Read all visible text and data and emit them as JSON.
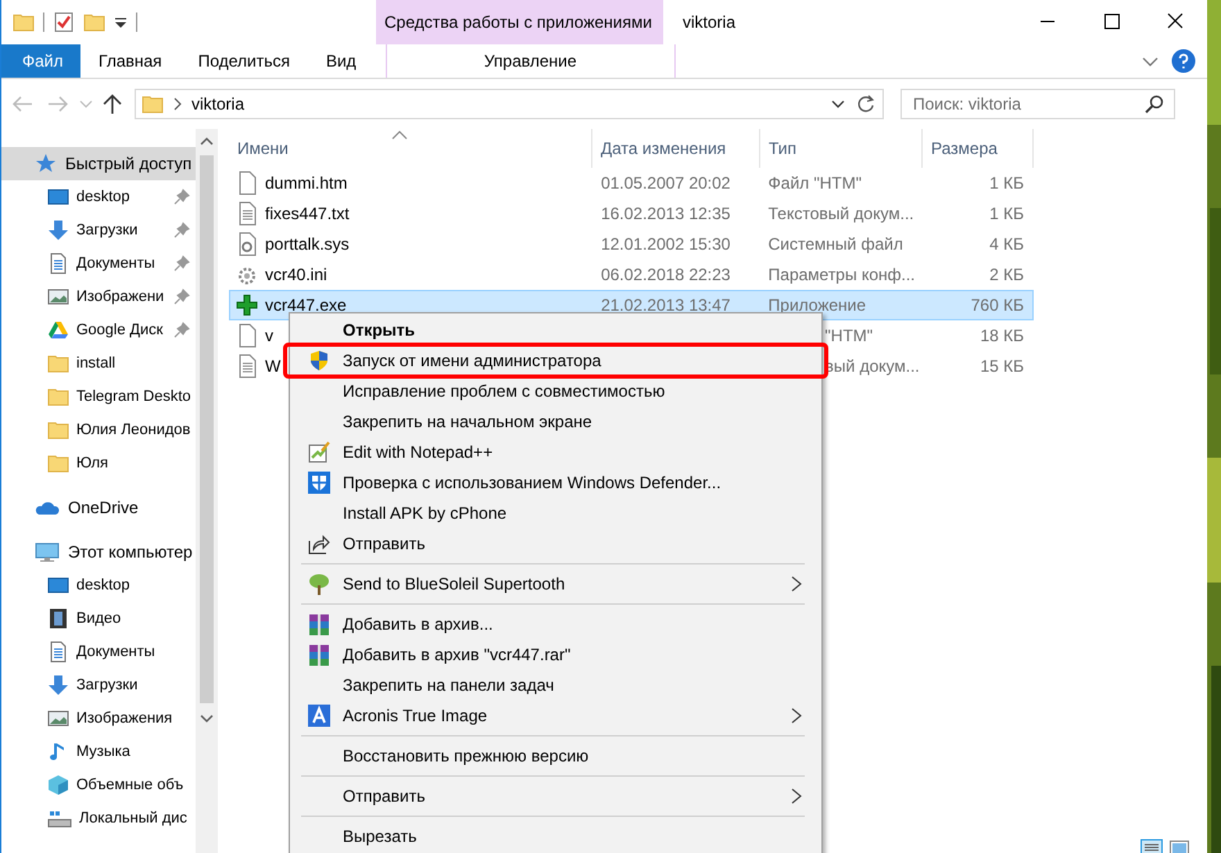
{
  "window": {
    "title": "viktoria",
    "context_group": "Средства работы с приложениями"
  },
  "ribbon": {
    "tabs": [
      {
        "label": "Файл",
        "kind": "file",
        "selected": false
      },
      {
        "label": "Главная",
        "kind": "tab",
        "selected": false
      },
      {
        "label": "Поделиться",
        "kind": "tab",
        "selected": false
      },
      {
        "label": "Вид",
        "kind": "tab",
        "selected": false
      },
      {
        "label": "Управление",
        "kind": "context",
        "selected": false
      }
    ]
  },
  "address": {
    "path": "viktoria",
    "search_placeholder": "Поиск: viktoria"
  },
  "sidebar": {
    "items": [
      {
        "label": "Быстрый доступ",
        "selected": true,
        "children": [
          {
            "label": "desktop",
            "pinned": true,
            "selected": false
          },
          {
            "label": "Загрузки",
            "pinned": true,
            "selected": false
          },
          {
            "label": "Документы",
            "pinned": true,
            "selected": false
          },
          {
            "label": "Изображени",
            "pinned": true,
            "selected": false
          },
          {
            "label": "Google Диск",
            "pinned": true,
            "selected": false
          },
          {
            "label": "install",
            "pinned": false,
            "selected": false
          },
          {
            "label": "Telegram Deskto",
            "pinned": false,
            "selected": false
          },
          {
            "label": "Юлия Леонидов",
            "pinned": false,
            "selected": false
          },
          {
            "label": "Юля",
            "pinned": false,
            "selected": false
          }
        ]
      },
      {
        "label": "OneDrive",
        "selected": false
      },
      {
        "label": "Этот компьютер",
        "selected": false,
        "children": [
          {
            "label": "desktop",
            "selected": false
          },
          {
            "label": "Видео",
            "selected": false
          },
          {
            "label": "Документы",
            "selected": false
          },
          {
            "label": "Загрузки",
            "selected": false
          },
          {
            "label": "Изображения",
            "selected": false
          },
          {
            "label": "Музыка",
            "selected": false
          },
          {
            "label": "Объемные объ",
            "selected": false
          },
          {
            "label": "Локальный дис",
            "selected": false
          }
        ]
      }
    ]
  },
  "table": {
    "columns": [
      "Имени",
      "Дата изменения",
      "Тип",
      "Размера"
    ],
    "rows": [
      {
        "name": "dummi.htm",
        "date": "01.05.2007 20:02",
        "type": "Файл \"HTM\"",
        "size": "1 КБ",
        "selected": false
      },
      {
        "name": "fixes447.txt",
        "date": "16.02.2013 12:35",
        "type": "Текстовый докум...",
        "size": "1 КБ",
        "selected": false
      },
      {
        "name": "porttalk.sys",
        "date": "12.01.2002 15:30",
        "type": "Системный файл",
        "size": "4 КБ",
        "selected": false
      },
      {
        "name": "vcr40.ini",
        "date": "06.02.2018 22:23",
        "type": "Параметры конф...",
        "size": "2 КБ",
        "selected": false
      },
      {
        "name": "vcr447.exe",
        "date": "21.02.2013 13:47",
        "type": "Приложение",
        "size": "760 КБ",
        "selected": true
      },
      {
        "name": "v",
        "type": "\"HTM\"",
        "size": "18 КБ",
        "selected": false
      },
      {
        "name": "W",
        "type": "вый докум...",
        "size": "15 КБ",
        "selected": false
      }
    ]
  },
  "context_menu": {
    "groups": [
      [
        {
          "label": "Открыть",
          "bold": true,
          "highlighted": false
        },
        {
          "label": "Запуск от имени администратора",
          "bold": false,
          "highlighted": true
        },
        {
          "label": "Исправление проблем с совместимостью",
          "bold": false,
          "highlighted": false
        },
        {
          "label": "Закрепить на начальном экране",
          "bold": false,
          "highlighted": false
        },
        {
          "label": "Edit with Notepad++",
          "bold": false,
          "highlighted": false
        },
        {
          "label": "Проверка с использованием Windows Defender...",
          "bold": false,
          "highlighted": false
        },
        {
          "label": "Install APK by cPhone",
          "bold": false,
          "highlighted": false
        },
        {
          "label": "Отправить",
          "bold": false,
          "highlighted": false
        }
      ],
      [
        {
          "label": "Send to BlueSoleil Supertooth",
          "bold": false,
          "highlighted": false,
          "submenu": true
        }
      ],
      [
        {
          "label": "Добавить в архив...",
          "bold": false,
          "highlighted": false
        },
        {
          "label": "Добавить в архив \"vcr447.rar\"",
          "bold": false,
          "highlighted": false
        },
        {
          "label": "Закрепить на панели задач",
          "bold": false,
          "highlighted": false
        },
        {
          "label": "Acronis True Image",
          "bold": false,
          "highlighted": false,
          "submenu": true
        }
      ],
      [
        {
          "label": "Восстановить прежнюю версию",
          "bold": false,
          "highlighted": false
        }
      ],
      [
        {
          "label": "Отправить",
          "bold": false,
          "highlighted": false,
          "submenu": true
        }
      ],
      [
        {
          "label": "Вырезать",
          "bold": false,
          "highlighted": false
        }
      ]
    ]
  }
}
